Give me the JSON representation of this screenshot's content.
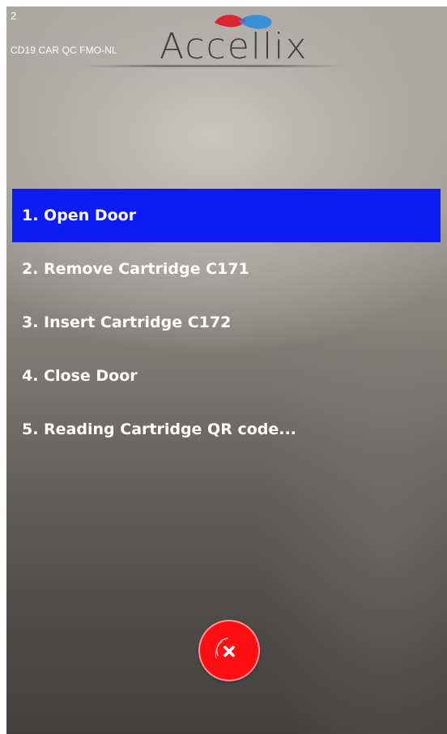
{
  "header": {
    "step_counter": "2",
    "protocol_name": "CD19 CAR QC FMO-NL",
    "logo_text": "Accellix"
  },
  "steps": [
    {
      "label": "1. Open Door",
      "active": true
    },
    {
      "label": "2. Remove Cartridge C171",
      "active": false
    },
    {
      "label": "3. Insert Cartridge C172",
      "active": false
    },
    {
      "label": "4. Close Door",
      "active": false
    },
    {
      "label": "5. Reading Cartridge QR code...",
      "active": false
    }
  ],
  "cancel_button": {
    "icon": "close-icon"
  },
  "colors": {
    "active_step": "#0d1cf2",
    "cancel": "#ff0f12",
    "logo_red": "#d9262f",
    "logo_blue": "#3a8fd9"
  }
}
